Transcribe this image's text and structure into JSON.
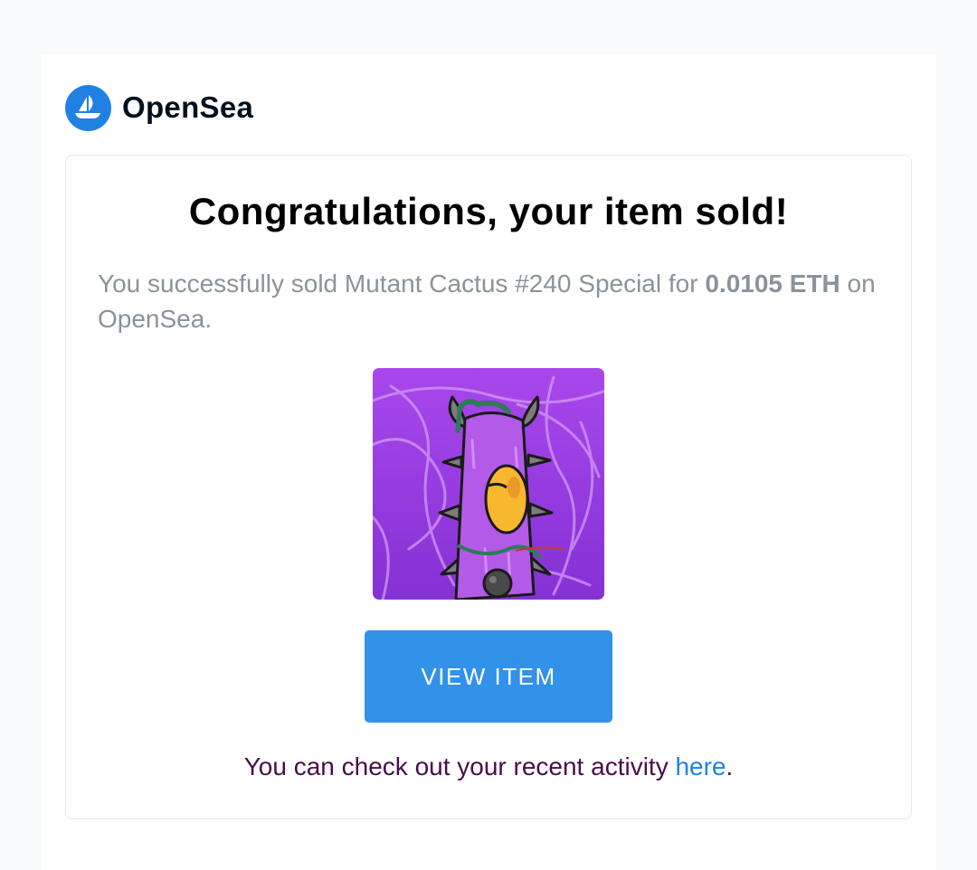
{
  "brand": {
    "name": "OpenSea",
    "logo_icon": "sailboat-icon",
    "color": "#2081e2"
  },
  "card": {
    "title": "Congratulations, your item sold!",
    "message_prefix": "You successfully sold Mutant Cactus #240 Special for",
    "price": "0.0105 ETH",
    "message_suffix": "on OpenSea.",
    "image_alt": "Mutant Cactus #240 Special",
    "button_label": "VIEW ITEM",
    "footer_text": "You can check out your recent activity",
    "footer_link": "here",
    "footer_end": "."
  },
  "colors": {
    "button": "#3291e9",
    "footer_text": "#4a0d4a",
    "link": "#2081e2",
    "nft_bg": "#9d3ee0"
  }
}
